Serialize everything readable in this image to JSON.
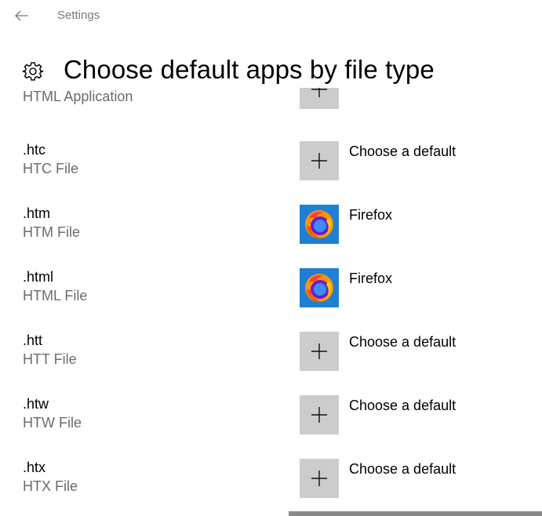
{
  "window": {
    "title": "Settings",
    "back_icon": "arrow-left-icon"
  },
  "header": {
    "icon": "gear-icon",
    "title": "Choose default apps by file type"
  },
  "rows": [
    {
      "ext": "",
      "desc": "HTML Application",
      "app": "",
      "app_icon": "plus-icon"
    },
    {
      "ext": ".htc",
      "desc": "HTC File",
      "app": "Choose a default",
      "app_icon": "plus-icon"
    },
    {
      "ext": ".htm",
      "desc": "HTM File",
      "app": "Firefox",
      "app_icon": "firefox-icon"
    },
    {
      "ext": ".html",
      "desc": "HTML File",
      "app": "Firefox",
      "app_icon": "firefox-icon"
    },
    {
      "ext": ".htt",
      "desc": "HTT File",
      "app": "Choose a default",
      "app_icon": "plus-icon"
    },
    {
      "ext": ".htw",
      "desc": "HTW File",
      "app": "Choose a default",
      "app_icon": "plus-icon"
    },
    {
      "ext": ".htx",
      "desc": "HTX File",
      "app": "Choose a default",
      "app_icon": "plus-icon"
    }
  ]
}
